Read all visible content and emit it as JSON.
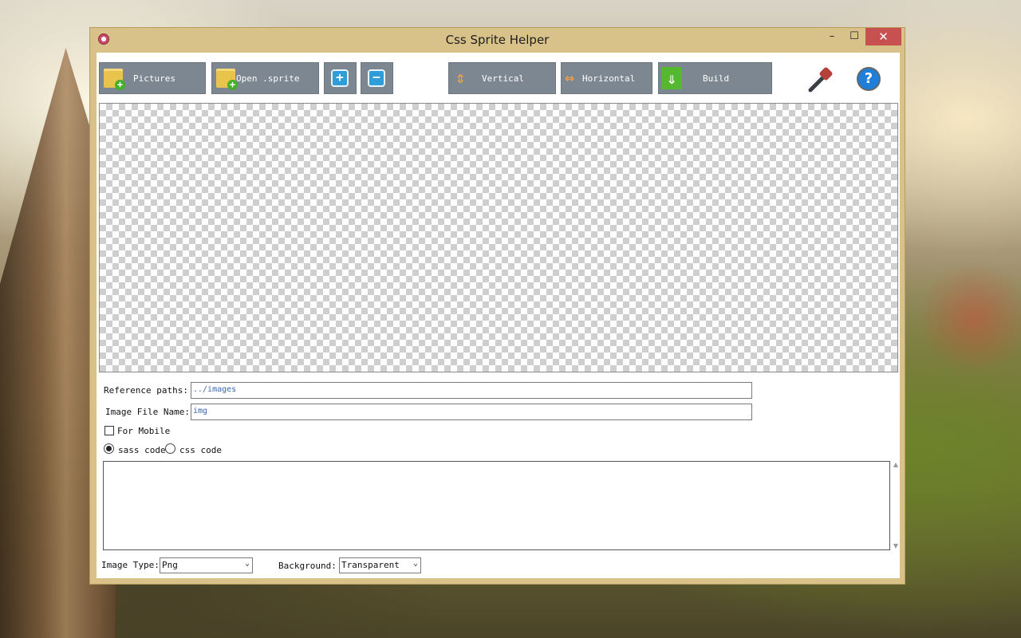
{
  "window": {
    "title": "Css Sprite Helper",
    "controls": {
      "minimize": "–",
      "maximize": "☐",
      "close": "✕"
    }
  },
  "toolbar": {
    "pictures_label": "Pictures",
    "open_sprite_label": "Open .sprite",
    "add_symbol": "+",
    "remove_symbol": "−",
    "vertical_label": "Vertical",
    "horizontal_label": "Horizontal",
    "build_label": "Build",
    "help_symbol": "?"
  },
  "form": {
    "reference_paths_label": "Reference paths:",
    "reference_paths_value": "../images",
    "image_file_name_label": "Image File Name:",
    "image_file_name_value": "img",
    "for_mobile_label": "For Mobile",
    "for_mobile_checked": false,
    "sass_code_label": "sass code",
    "css_code_label": "css code",
    "selected_code_type": "sass code",
    "code_output": "",
    "image_type_label": "Image Type:",
    "image_type_value": "Png",
    "background_label": "Background:",
    "background_value": "Transparent"
  },
  "icons": {
    "app": "app-icon",
    "pictures": "folder-add-icon",
    "open_sprite": "folder-add-icon",
    "add": "plus-square-icon",
    "remove": "minus-square-icon",
    "vertical": "vertical-arrows-icon",
    "horizontal": "horizontal-arrows-icon",
    "build": "download-arrow-icon",
    "tool": "color-picker-icon",
    "help": "help-icon"
  },
  "colors": {
    "window_frame": "#d9c28a",
    "toolbar_button": "#7c8792",
    "close_button": "#c75050",
    "input_text": "#3a66b0"
  }
}
